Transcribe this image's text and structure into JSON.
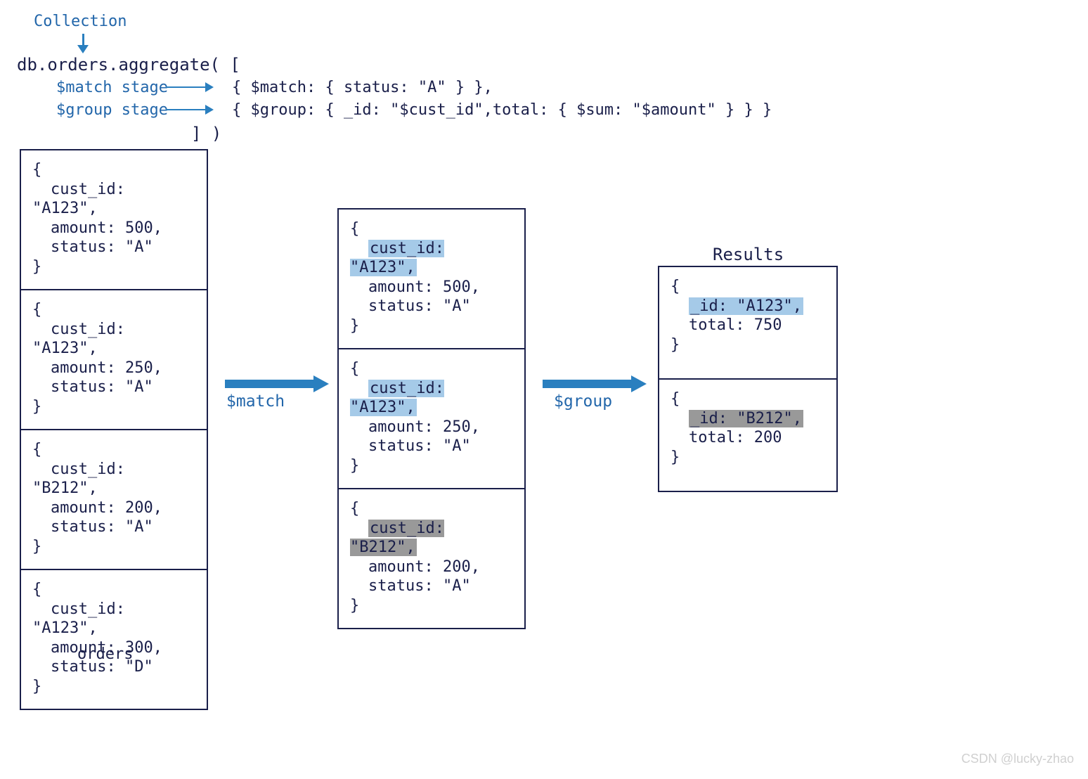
{
  "header": {
    "collection_label": "Collection",
    "aggregate_open": "db.orders.aggregate( [",
    "match_stage_label": "$match stage",
    "group_stage_label": "$group stage",
    "match_line": "{ $match: { status: \"A\" } },",
    "group_line": "{ $group: { _id: \"$cust_id\",total: { $sum: \"$amount\" } } }",
    "aggregate_close": "] )"
  },
  "arrows": {
    "match_op": "$match",
    "group_op": "$group"
  },
  "orders": {
    "label": "orders",
    "docs": [
      {
        "cust_id": "cust_id: \"A123\",",
        "amount": "amount: 500,",
        "status": "status: \"A\""
      },
      {
        "cust_id": "cust_id: \"A123\",",
        "amount": "amount: 250,",
        "status": "status: \"A\""
      },
      {
        "cust_id": "cust_id: \"B212\",",
        "amount": "amount: 200,",
        "status": "status: \"A\""
      },
      {
        "cust_id": "cust_id: \"A123\",",
        "amount": "amount: 300,",
        "status": "status: \"D\""
      }
    ]
  },
  "matched": {
    "docs": [
      {
        "cust_id": "cust_id: \"A123\",",
        "amount": "amount: 500,",
        "status": "status: \"A\"",
        "hl": "blue"
      },
      {
        "cust_id": "cust_id: \"A123\",",
        "amount": "amount: 250,",
        "status": "status: \"A\"",
        "hl": "blue"
      },
      {
        "cust_id": "cust_id: \"B212\",",
        "amount": "amount: 200,",
        "status": "status: \"A\"",
        "hl": "gray"
      }
    ]
  },
  "results": {
    "label": "Results",
    "docs": [
      {
        "id": "_id: \"A123\",",
        "total": "total: 750",
        "hl": "blue"
      },
      {
        "id": "_id: \"B212\",",
        "total": "total: 200",
        "hl": "gray"
      }
    ]
  },
  "watermark": "CSDN @lucky-zhao"
}
